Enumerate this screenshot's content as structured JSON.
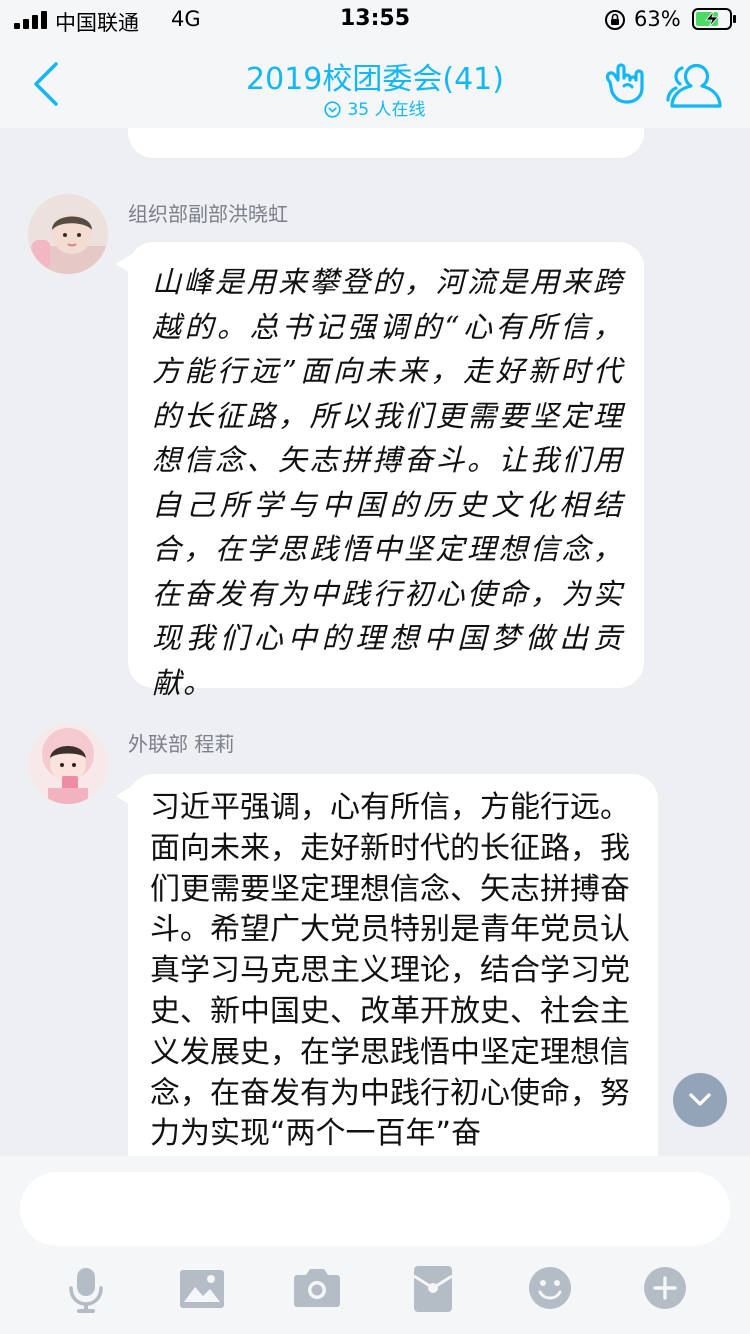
{
  "status_bar": {
    "carrier": "中国联通",
    "network": "4G",
    "time": "13:55",
    "battery": "63%"
  },
  "header": {
    "title": "2019校团委会(41)",
    "online_status": "35 人在线"
  },
  "messages": [
    {
      "sender": "组织部副部洪晓虹",
      "text": "山峰是用来攀登的，河流是用来跨越的。总书记强调的“心有所信，方能行远”面向未来，走好新时代的长征路，所以我们更需要坚定理想信念、矢志拼搏奋斗。让我们用自己所学与中国的历史文化相结合，在学思践悟中坚定理想信念，在奋发有为中践行初心使命，为实现我们心中的理想中国梦做出贡献。"
    },
    {
      "sender": "外联部 程莉",
      "text": "习近平强调，心有所信，方能行远。面向未来，走好新时代的长征路，我们更需要坚定理想信念、矢志拼搏奋斗。希望广大党员特别是青年党员认真学习马克思主义理论，结合学习党史、新中国史、改革开放史、社会主义发展史，在学思践悟中坚定理想信念，在奋发有为中践行初心使命，努力为实现“两个一百年”奋"
    }
  ],
  "input": {
    "value": ""
  },
  "toolbar": [
    "microphone-icon",
    "image-icon",
    "camera-icon",
    "red-packet-icon",
    "emoji-icon",
    "plus-icon"
  ],
  "colors": {
    "accent": "#12b7f5",
    "chat_background": "#edeff2",
    "bubble": "#ffffff",
    "toolbar_icon": "#b4bcc6"
  }
}
